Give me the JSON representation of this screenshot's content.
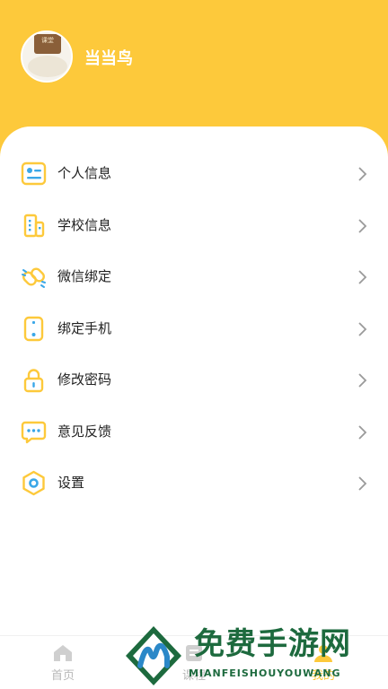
{
  "colors": {
    "accent": "#fdc93b",
    "icon_blue": "#3aa7e8",
    "text": "#222222",
    "tab_inactive": "#b8b8b8"
  },
  "profile": {
    "avatar_icon": "avatar-image",
    "avatar_text": "课堂",
    "username": "当当鸟"
  },
  "menu": {
    "items": [
      {
        "label": "个人信息",
        "icon": "id-card-icon"
      },
      {
        "label": "学校信息",
        "icon": "building-icon"
      },
      {
        "label": "微信绑定",
        "icon": "link-icon"
      },
      {
        "label": "绑定手机",
        "icon": "phone-icon"
      },
      {
        "label": "修改密码",
        "icon": "lock-icon"
      },
      {
        "label": "意见反馈",
        "icon": "chat-bubble-icon"
      },
      {
        "label": "设置",
        "icon": "settings-hexagon-icon"
      }
    ]
  },
  "tabbar": {
    "tabs": [
      {
        "label": "首页",
        "icon": "home-icon",
        "active": false
      },
      {
        "label": "课程",
        "icon": "course-icon",
        "active": false
      },
      {
        "label": "",
        "icon": "",
        "active": false
      },
      {
        "label": "我的",
        "icon": "user-icon",
        "active": true
      }
    ]
  },
  "watermark": {
    "title": "免费手游网",
    "subtitle": "MIANFEISHOUYOUWANG"
  }
}
